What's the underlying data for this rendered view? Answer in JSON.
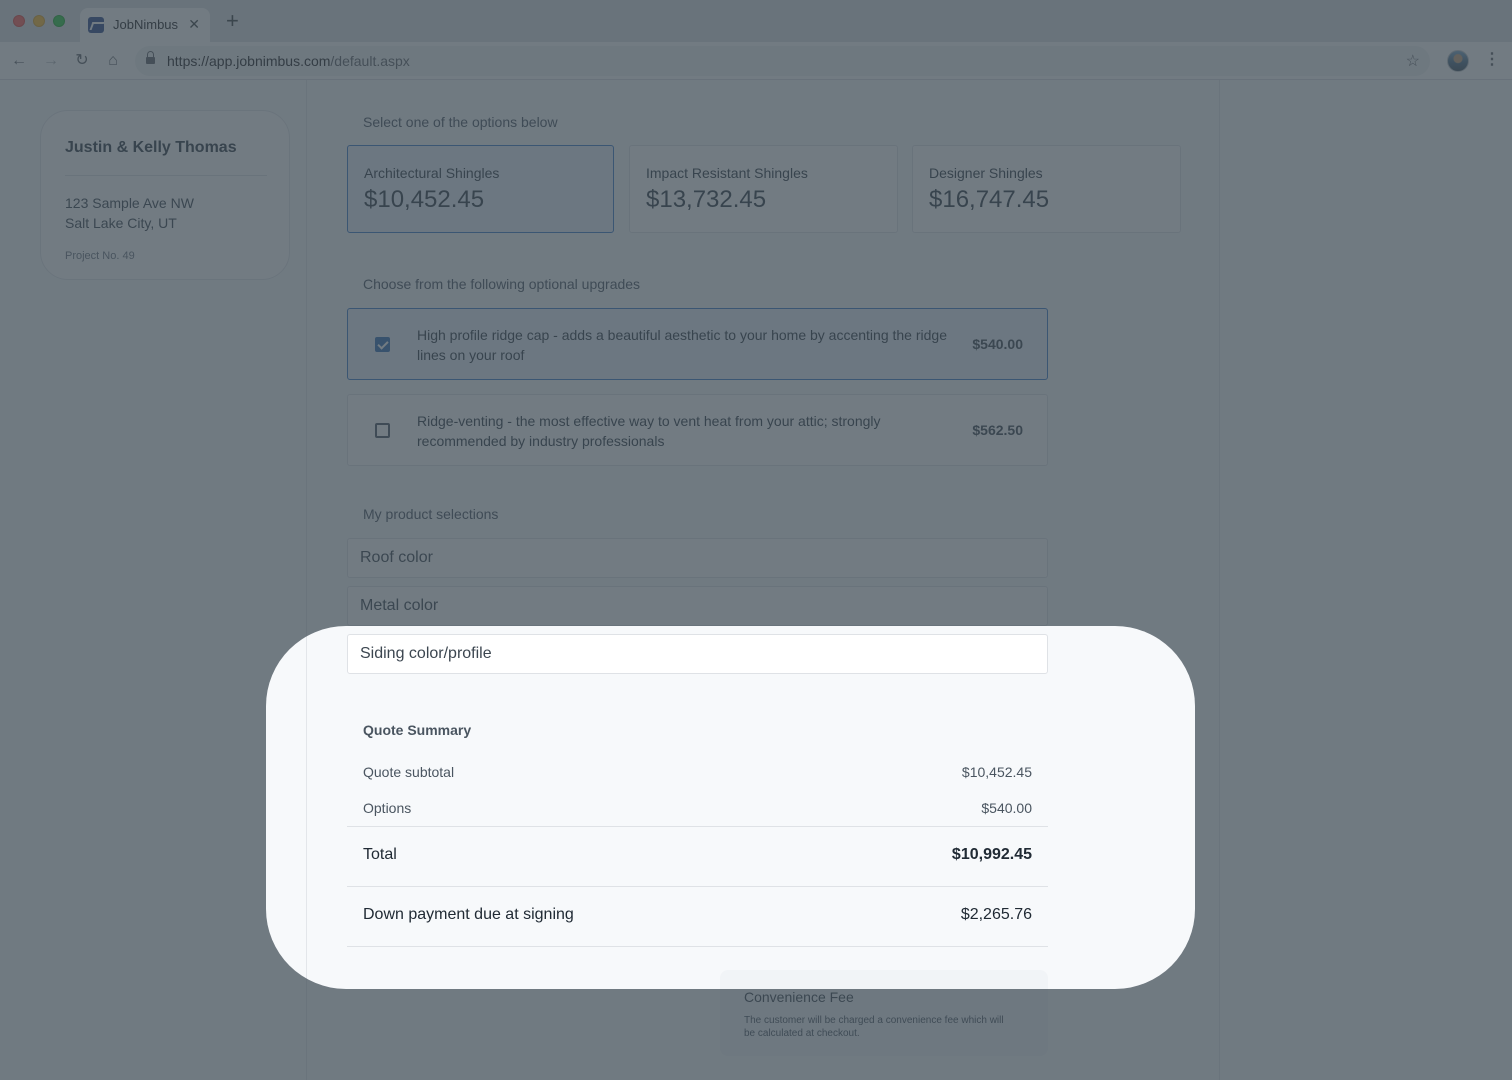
{
  "browser": {
    "tab_title": "JobNimbus",
    "tab_close": "✕",
    "new_tab": "+",
    "url_host": "https://app.jobnimbus.com",
    "url_path": "/default.aspx"
  },
  "customer": {
    "name": "Justin & Kelly Thomas",
    "address_line1": "123 Sample Ave NW",
    "address_line2": "Salt Lake City, UT",
    "project_no": "Project No. 49"
  },
  "options_section": {
    "label": "Select one of the options below",
    "options": [
      {
        "name": "Architectural Shingles",
        "price": "$10,452.45",
        "selected": true
      },
      {
        "name": "Impact Resistant Shingles",
        "price": "$13,732.45",
        "selected": false
      },
      {
        "name": "Designer Shingles",
        "price": "$16,747.45",
        "selected": false
      }
    ]
  },
  "upgrades_section": {
    "label": "Choose from the following optional upgrades",
    "items": [
      {
        "text": "High profile ridge cap - adds a beautiful aesthetic to your home by accenting the ridge lines on your roof",
        "price": "$540.00",
        "checked": true
      },
      {
        "text": "Ridge-venting - the most effective way to vent heat from your attic; strongly recommended by industry professionals",
        "price": "$562.50",
        "checked": false
      }
    ]
  },
  "products_section": {
    "label": "My product selections",
    "fields": [
      "Roof color",
      "Metal color",
      "Siding color/profile"
    ]
  },
  "summary": {
    "title": "Quote Summary",
    "subtotal_label": "Quote subtotal",
    "subtotal_value": "$10,452.45",
    "options_label": "Options",
    "options_value": "$540.00",
    "total_label": "Total",
    "total_value": "$10,992.45",
    "down_label": "Down payment due at signing",
    "down_value": "$2,265.76"
  },
  "fee": {
    "title": "Convenience Fee",
    "note": "The customer will be charged a convenience fee which will be calculated at checkout."
  },
  "colors": {
    "accent": "#3b79c8",
    "overlay": "#3c4852"
  }
}
